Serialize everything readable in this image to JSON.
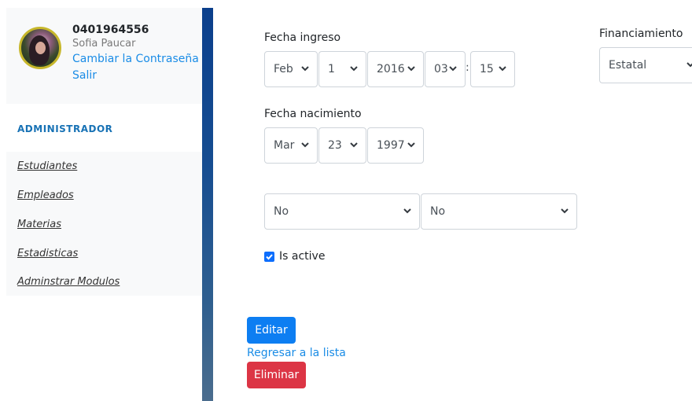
{
  "profile": {
    "id": "0401964556",
    "name": "Sofia Paucar",
    "change_password": "Cambiar la Contraseña",
    "logout": "Salir"
  },
  "sidebar": {
    "role": "ADMINISTRADOR",
    "items": [
      {
        "label": "Estudiantes"
      },
      {
        "label": "Empleados"
      },
      {
        "label": "Materias"
      },
      {
        "label": "Estadisticas"
      },
      {
        "label": "Adminstrar Modulos"
      }
    ]
  },
  "form": {
    "fecha_ingreso": {
      "label": "Fecha ingreso",
      "month": "Feb",
      "day": "1",
      "year": "2016",
      "hour": "03",
      "separator": ":",
      "minute": "15"
    },
    "financiamiento": {
      "label": "Financiamiento",
      "value": "Estatal"
    },
    "fecha_nacimiento": {
      "label": "Fecha nacimiento",
      "month": "Mar",
      "day": "23",
      "year": "1997"
    },
    "select_a": "No",
    "select_b": "No",
    "is_active": {
      "label": "Is active",
      "checked": true
    }
  },
  "actions": {
    "edit": "Editar",
    "back": "Regresar a la lista",
    "delete": "Eliminar"
  },
  "colors": {
    "primary": "#0d7ef2",
    "danger": "#dc3545",
    "link": "#1a8ce6",
    "role": "#1872b5",
    "sidebar_bar": "#0b3f8c"
  }
}
